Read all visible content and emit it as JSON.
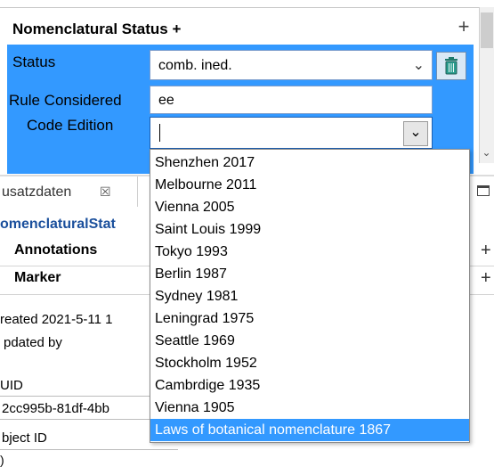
{
  "section": {
    "title": "Nomenclatural Status +",
    "add_symbol": "+"
  },
  "form": {
    "status_label": "Status",
    "status_value": "comb. ined.",
    "rule_label": "Rule Considered",
    "rule_value": "ee",
    "code_label": "Code Edition"
  },
  "dropdown": {
    "options": [
      "Shenzhen 2017",
      "Melbourne 2011",
      "Vienna 2005",
      "Saint Louis 1999",
      "Tokyo 1993",
      "Berlin 1987",
      "Sydney 1981",
      "Leningrad 1975",
      "Seattle 1969",
      "Stockholm 1952",
      "Cambrdige 1935",
      "Vienna 1905",
      "Laws of botanical nomenclature 1867"
    ],
    "selected_index": 12
  },
  "lower": {
    "tab_label": "usatzdaten",
    "tab_close": "☒",
    "breadcrumb": "omenclaturalStat",
    "annotations_label": "Annotations",
    "marker_label": "Marker",
    "add_symbol": "+",
    "created_text": "reated 2021-5-11 1",
    "updated_text": "pdated  by",
    "uid_label": "UID",
    "uid_value": "2cc995b-81df-4bb",
    "object_id_label": "bject ID",
    "bottom_fragment": ")"
  },
  "colors": {
    "selection_blue": "#3399ff",
    "link_blue": "#1a4f9c"
  }
}
